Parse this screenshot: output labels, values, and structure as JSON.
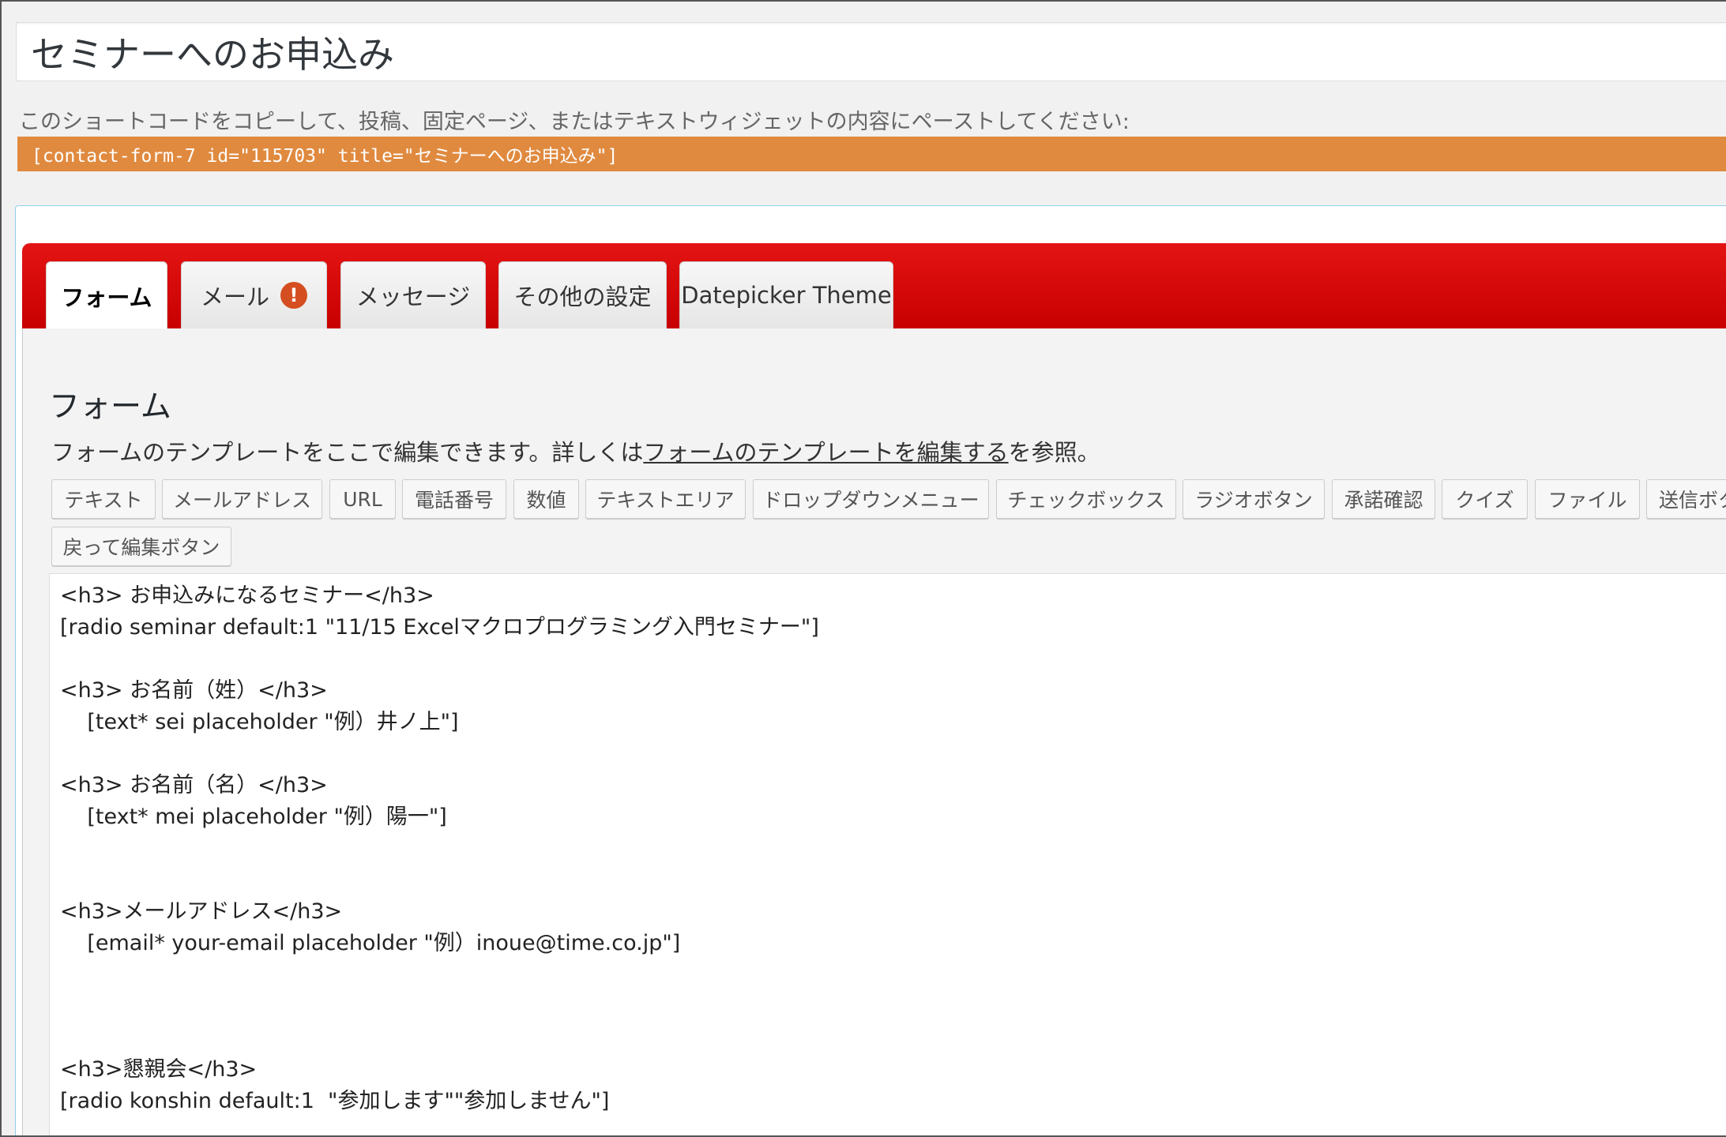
{
  "form_title": "セミナーへのお申込み",
  "shortcode": {
    "description": "このショートコードをコピーして、投稿、固定ページ、またはテキストウィジェットの内容にペーストしてください:",
    "code": "[contact-form-7 id=\"115703\" title=\"セミナーへのお申込み\"]"
  },
  "tabs": [
    {
      "label": "フォーム",
      "active": true
    },
    {
      "label": "メール",
      "alert": "!"
    },
    {
      "label": "メッセージ"
    },
    {
      "label": "その他の設定"
    },
    {
      "label": "Datepicker Theme"
    }
  ],
  "panel": {
    "heading": "フォーム",
    "desc_before": "フォームのテンプレートをここで編集できます。詳しくは",
    "desc_link": "フォームのテンプレートを編集する",
    "desc_after": "を参照。"
  },
  "tag_buttons": [
    "テキスト",
    "メールアドレス",
    "URL",
    "電話番号",
    "数値",
    "テキストエリア",
    "ドロップダウンメニュー",
    "チェックボックス",
    "ラジオボタン",
    "承諾確認",
    "クイズ",
    "ファイル",
    "送信ボタン",
    "戻って編集ボタン"
  ],
  "template_lines": [
    "<h3> お申込みになるセミナー</h3>",
    "[radio seminar default:1 \"11/15 Excelマクロプログラミング入門セミナー\"]",
    "",
    "<h3> お名前（姓）</h3>",
    "    [text* sei placeholder \"例）井ノ上\"]",
    "",
    "<h3> お名前（名）</h3>",
    "    [text* mei placeholder \"例）陽一\"]",
    "",
    "",
    "<h3>メールアドレス</h3>",
    "    [email* your-email placeholder \"例）inoue@time.co.jp\"]",
    "",
    "",
    "",
    "<h3>懇親会</h3>",
    "[radio konshin default:1  \"参加します\"\"参加しません\"]"
  ]
}
